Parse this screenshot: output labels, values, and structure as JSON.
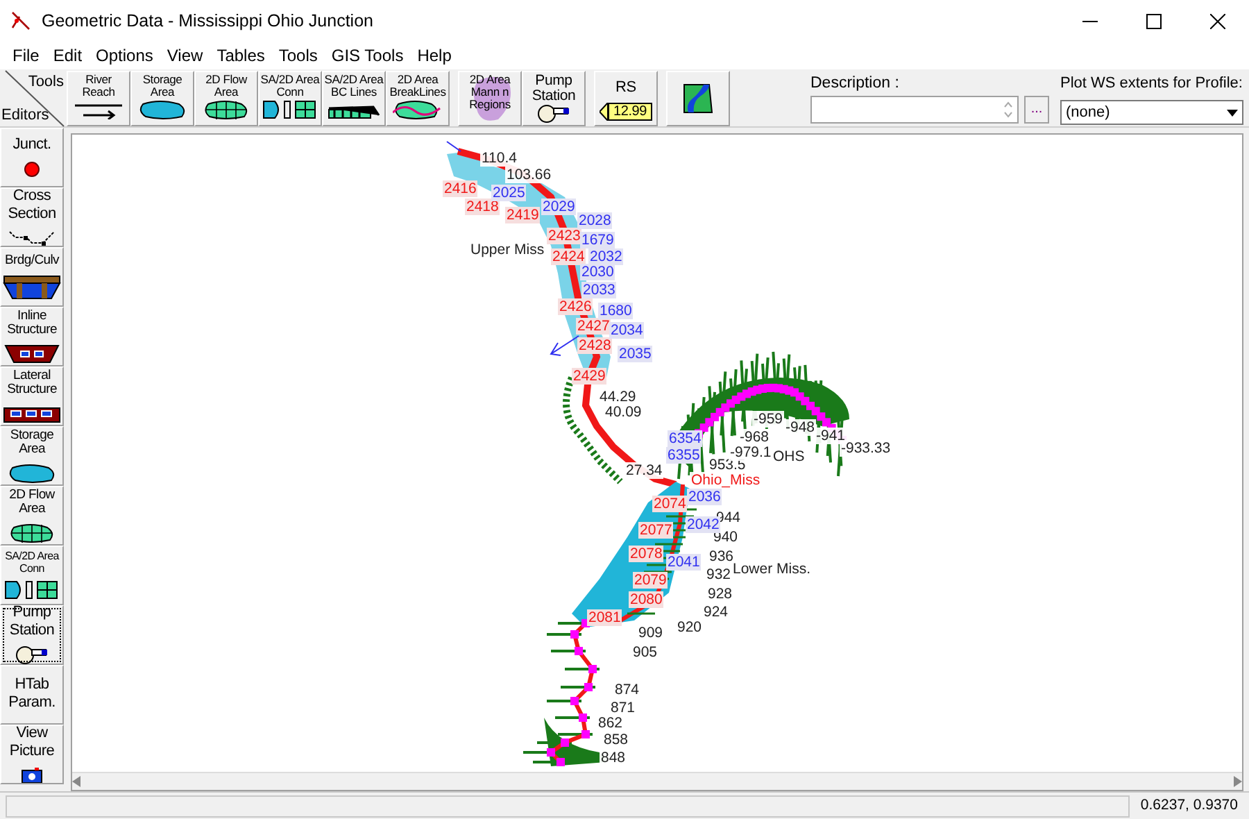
{
  "window": {
    "title": "Geometric Data - Mississippi Ohio Junction"
  },
  "menu": [
    "File",
    "Edit",
    "Options",
    "View",
    "Tables",
    "Tools",
    "GIS Tools",
    "Help"
  ],
  "toolbar": {
    "corner": {
      "top": "Tools",
      "bottom": "Editors"
    },
    "tools": [
      {
        "kind": "reach",
        "label": "River\nReach"
      },
      {
        "kind": "storage",
        "label": "Storage\nArea"
      },
      {
        "kind": "flow2d",
        "label": "2D Flow\nArea"
      },
      {
        "kind": "conn",
        "label": "SA/2D Area\nConn"
      },
      {
        "kind": "bclines",
        "label": "SA/2D Area\nBC Lines"
      },
      {
        "kind": "breaklines",
        "label": "2D Area\nBreakLines"
      },
      {
        "kind": "mann",
        "label": "2D Area\nMann n\nRegions"
      },
      {
        "kind": "pump",
        "label": "Pump\nStation"
      },
      {
        "kind": "rs",
        "label": "RS",
        "tag": "12.99"
      },
      {
        "kind": "map"
      }
    ],
    "description": {
      "label": "Description :",
      "browse": "..."
    },
    "profile": {
      "label": "Plot WS extents for Profile:",
      "value": "(none)"
    }
  },
  "editors": [
    {
      "kind": "junction",
      "label": "Junct.",
      "selected": false
    },
    {
      "kind": "xs",
      "label": "Cross\nSection",
      "selected": false
    },
    {
      "kind": "bridge",
      "label": "Brdg/Culv",
      "selected": false
    },
    {
      "kind": "inline",
      "label": "Inline\nStructure",
      "selected": false
    },
    {
      "kind": "lateral",
      "label": "Lateral\nStructure",
      "selected": false
    },
    {
      "kind": "storage",
      "label": "Storage\nArea",
      "selected": false
    },
    {
      "kind": "flow2d",
      "label": "2D Flow\nArea",
      "selected": false
    },
    {
      "kind": "conn",
      "label": "SA/2D Area\nConn",
      "selected": false
    },
    {
      "kind": "pump",
      "label": "Pump\nStation",
      "selected": true
    },
    {
      "kind": "text",
      "label": "HTab\nParam.",
      "selected": false
    },
    {
      "kind": "picture",
      "label": "View\nPicture",
      "selected": false
    }
  ],
  "map": {
    "labels": [
      {
        "kind": "station",
        "text": "110.4"
      },
      {
        "kind": "station",
        "text": "103.66"
      },
      {
        "kind": "station",
        "text": "44.29"
      },
      {
        "kind": "station",
        "text": "40.09"
      },
      {
        "kind": "station",
        "text": "27.34"
      },
      {
        "kind": "station",
        "text": "953.5"
      },
      {
        "kind": "station",
        "text": "-959"
      },
      {
        "kind": "station",
        "text": "-948"
      },
      {
        "kind": "station",
        "text": "-941"
      },
      {
        "kind": "station",
        "text": "-933.33"
      },
      {
        "kind": "station",
        "text": "-968"
      },
      {
        "kind": "station",
        "text": "-979.1"
      },
      {
        "kind": "station",
        "text": "944"
      },
      {
        "kind": "station",
        "text": "940"
      },
      {
        "kind": "station",
        "text": "936"
      },
      {
        "kind": "station",
        "text": "932"
      },
      {
        "kind": "station",
        "text": "928"
      },
      {
        "kind": "station",
        "text": "924"
      },
      {
        "kind": "station",
        "text": "920"
      },
      {
        "kind": "station",
        "text": "909"
      },
      {
        "kind": "station",
        "text": "905"
      },
      {
        "kind": "station",
        "text": "874"
      },
      {
        "kind": "station",
        "text": "871"
      },
      {
        "kind": "station",
        "text": "862"
      },
      {
        "kind": "station",
        "text": "858"
      },
      {
        "kind": "station",
        "text": "848"
      },
      {
        "kind": "node",
        "text": "2416"
      },
      {
        "kind": "node",
        "text": "2418"
      },
      {
        "kind": "node",
        "text": "2419"
      },
      {
        "kind": "node",
        "text": "2423"
      },
      {
        "kind": "node",
        "text": "2424"
      },
      {
        "kind": "node",
        "text": "2426"
      },
      {
        "kind": "node",
        "text": "2427"
      },
      {
        "kind": "node",
        "text": "2428"
      },
      {
        "kind": "node",
        "text": "2429"
      },
      {
        "kind": "node",
        "text": "2074"
      },
      {
        "kind": "node",
        "text": "2077"
      },
      {
        "kind": "node",
        "text": "2078"
      },
      {
        "kind": "node",
        "text": "2079"
      },
      {
        "kind": "node",
        "text": "2080"
      },
      {
        "kind": "node",
        "text": "2081"
      },
      {
        "kind": "point",
        "text": "2025"
      },
      {
        "kind": "point",
        "text": "2029"
      },
      {
        "kind": "point",
        "text": "2028"
      },
      {
        "kind": "point",
        "text": "1679"
      },
      {
        "kind": "point",
        "text": "2032"
      },
      {
        "kind": "point",
        "text": "2030"
      },
      {
        "kind": "point",
        "text": "2033"
      },
      {
        "kind": "point",
        "text": "1680"
      },
      {
        "kind": "point",
        "text": "2034"
      },
      {
        "kind": "point",
        "text": "2035"
      },
      {
        "kind": "point",
        "text": "6354"
      },
      {
        "kind": "point",
        "text": "6355"
      },
      {
        "kind": "point",
        "text": "2036"
      },
      {
        "kind": "point",
        "text": "2042"
      },
      {
        "kind": "point",
        "text": "2041"
      },
      {
        "kind": "reach",
        "text": "Upper Miss"
      },
      {
        "kind": "reach",
        "text": "OHS"
      },
      {
        "kind": "reach",
        "text": "Lower Miss."
      },
      {
        "kind": "junction",
        "text": "Ohio_Miss"
      }
    ]
  },
  "status_bar": {
    "coordinates": "0.6237, 0.9370"
  }
}
